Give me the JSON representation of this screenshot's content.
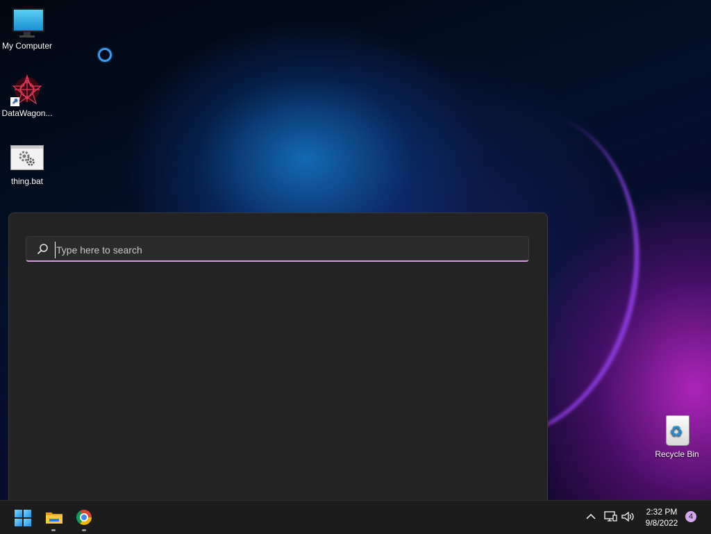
{
  "desktop": {
    "icons": [
      {
        "label": "My Computer",
        "icon": "monitor-icon"
      },
      {
        "label": "DataWagon...",
        "icon": "datawagon-app-icon"
      },
      {
        "label": "thing.bat",
        "icon": "batch-file-icon"
      },
      {
        "label": "Recycle Bin",
        "icon": "recycle-bin-icon"
      }
    ]
  },
  "search": {
    "placeholder": "Type here to search",
    "value": ""
  },
  "taskbar": {
    "apps": [
      {
        "name": "Start",
        "icon": "windows-icon"
      },
      {
        "name": "File Explorer",
        "icon": "folder-icon"
      },
      {
        "name": "Google Chrome",
        "icon": "chrome-icon"
      }
    ],
    "tray": {
      "time": "2:32 PM",
      "date": "9/8/2022",
      "notification_count": "4"
    }
  },
  "colors": {
    "accent": "#d39be0",
    "panel_bg": "#232323",
    "taskbar_bg": "#1c1c1c"
  }
}
